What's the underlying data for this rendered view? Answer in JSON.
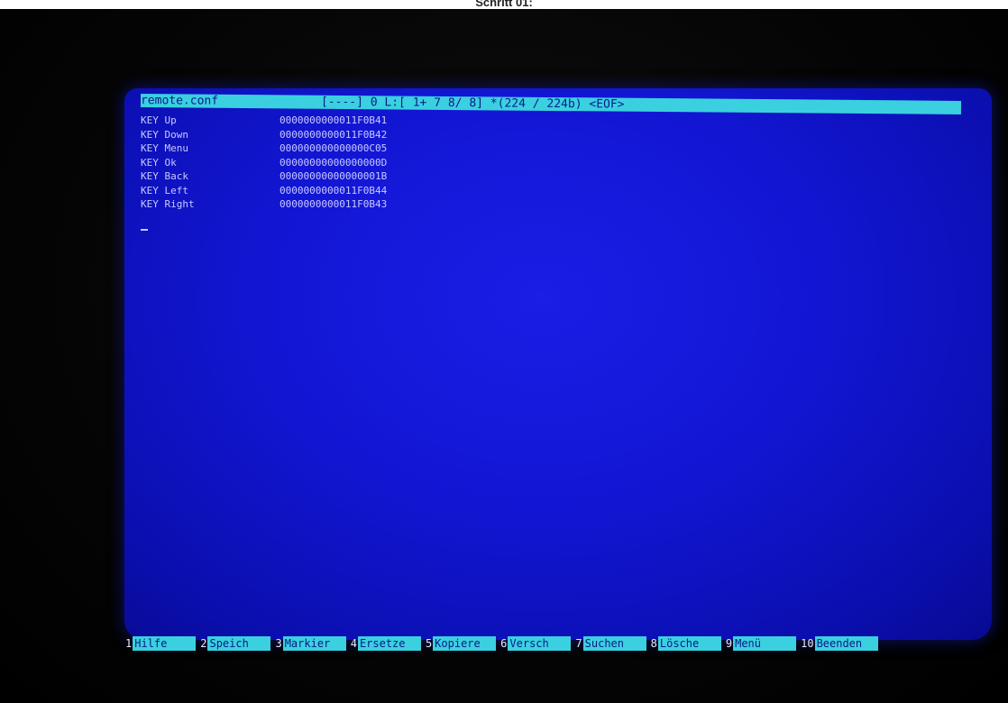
{
  "photo_caption": "Schritt 01:",
  "editor": {
    "filename": "remote.conf",
    "status": "[----]  0 L:[  1+ 7   8/  8] *(224 / 224b) <EOF>",
    "lines": [
      {
        "key": "KEY Up",
        "code": "0000000000011F0B41"
      },
      {
        "key": "KEY Down",
        "code": "0000000000011F0B42"
      },
      {
        "key": "KEY Menu",
        "code": "000000000000000C05"
      },
      {
        "key": "KEY Ok",
        "code": "00000000000000000D"
      },
      {
        "key": "KEY Back",
        "code": "00000000000000001B"
      },
      {
        "key": "KEY Left",
        "code": "0000000000011F0B44"
      },
      {
        "key": "KEY Right",
        "code": "0000000000011F0B43"
      }
    ]
  },
  "function_keys": [
    {
      "num": "1",
      "label": "Hilfe"
    },
    {
      "num": "2",
      "label": "Speich"
    },
    {
      "num": "3",
      "label": "Markier"
    },
    {
      "num": "4",
      "label": "Ersetze"
    },
    {
      "num": "5",
      "label": "Kopiere"
    },
    {
      "num": "6",
      "label": "Versch"
    },
    {
      "num": "7",
      "label": "Suchen"
    },
    {
      "num": "8",
      "label": "Lösche"
    },
    {
      "num": "9",
      "label": "Menü"
    },
    {
      "num": "10",
      "label": "Beenden"
    }
  ],
  "colors": {
    "screen_blue": "#1216d2",
    "bar_cyan": "#3ad0df",
    "text_light": "#c9c9ff"
  }
}
